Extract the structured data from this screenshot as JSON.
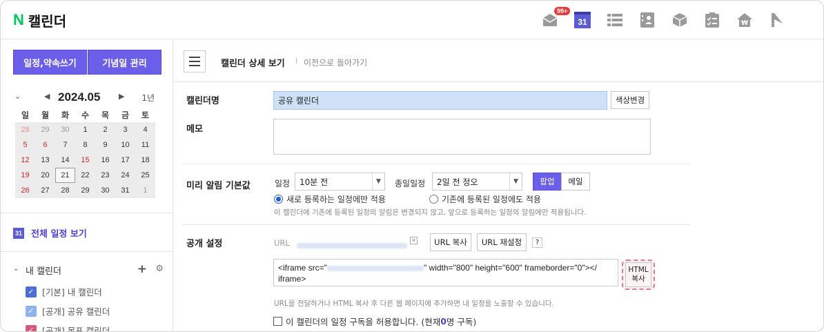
{
  "app": {
    "logo_letter": "N",
    "title": "캘린더"
  },
  "topbar": {
    "mail_badge": "99+",
    "calendar_icon_text": "31",
    "icons": [
      "mail-icon",
      "calendar-icon",
      "list-icon",
      "contacts-icon",
      "box-icon",
      "checklist-icon",
      "home-won-icon",
      "flag-icon"
    ]
  },
  "sidebar": {
    "write_button": "일정,약속쓰기",
    "anniversary_button": "기념일 관리",
    "mini_calendar": {
      "title": "2024.05",
      "year_link": "1년",
      "weekdays": [
        "일",
        "월",
        "화",
        "수",
        "목",
        "금",
        "토"
      ],
      "weeks": [
        [
          "28",
          "29",
          "30",
          "1",
          "2",
          "3",
          "4"
        ],
        [
          "5",
          "6",
          "7",
          "8",
          "9",
          "10",
          "11"
        ],
        [
          "12",
          "13",
          "14",
          "15",
          "16",
          "17",
          "18"
        ],
        [
          "19",
          "20",
          "21",
          "22",
          "23",
          "24",
          "25"
        ],
        [
          "26",
          "27",
          "28",
          "29",
          "30",
          "31",
          "1"
        ]
      ],
      "today": "21"
    },
    "all_view_icon": "31",
    "all_view_label": "전체 일정 보기",
    "my_calendars_title": "내 캘린더",
    "calendars": [
      {
        "label": "[기본] 내 캘린더",
        "color": "#4b6fd9",
        "checked": true
      },
      {
        "label": "[공개] 공유 캘린더",
        "color": "#8fb3ec",
        "checked": true
      },
      {
        "label": "[공개] 목표 캘린더",
        "color": "#d9577a",
        "checked": true
      }
    ]
  },
  "main": {
    "header_title": "캘린더 상세 보기",
    "header_sep": "I",
    "back_link": "이전으로 돌아가기",
    "name_label": "캘린더명",
    "name_value": "공유 캘린더",
    "color_change_button": "색상변경",
    "memo_label": "메모",
    "memo_value": "",
    "alert": {
      "label": "미리 알림 기본값",
      "event_label": "일정",
      "event_value": "10분 전",
      "allday_label": "종일일정",
      "allday_value": "2일 전 정오",
      "popup_button": "팝업",
      "email_button": "메일",
      "radio_new": "새로 등록하는 일정에만 적용",
      "radio_existing": "기존에 등록된 일정에도 적용",
      "note": "이 캘린더에 기존에 등록된 일정의 알림은 변경되지 않고, 앞으로 등록하는 일정의 알림에만 적용됩니다."
    },
    "public": {
      "label": "공개 설정",
      "url_label": "URL",
      "url_close": "✕",
      "url_copy_button": "URL 복사",
      "url_reset_button": "URL 재설정",
      "help_button": "?",
      "iframe_prefix": "<iframe src=\"",
      "iframe_suffix": "\" width=\"800\" height=\"600\" frameborder=\"0\"></",
      "iframe_end": "iframe>",
      "html_copy_line1": "HTML",
      "html_copy_line2": "복사",
      "note": "URL을 전달하거나 HTML 복사 후 다른 웹 페이지에 추가하면 내 일정을 노출할 수 있습니다.",
      "subscribe_text": "이 캘린더의 일정 구독을 허용합니다. (현재 ",
      "subscribe_count": "0",
      "subscribe_suffix": "명 구독)"
    }
  },
  "colors": {
    "accent": "#6b5ee8",
    "brand_green": "#03c75a",
    "highlight": "#e07a8a",
    "input_bg": "#cfe1f7"
  }
}
